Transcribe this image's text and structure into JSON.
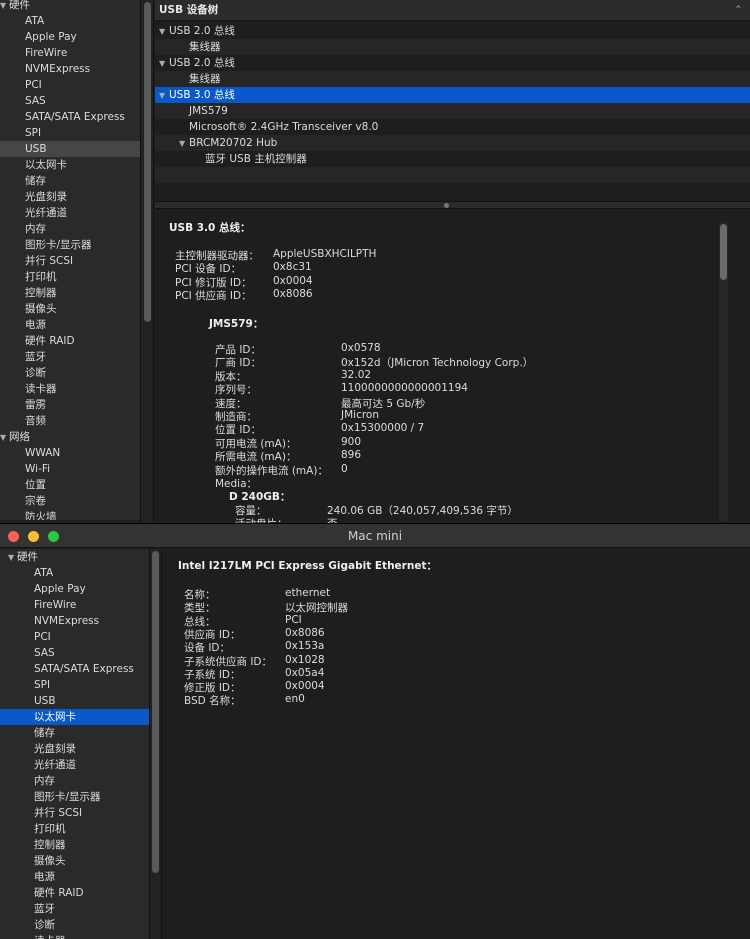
{
  "win1": {
    "sidebar": [
      {
        "kind": "group",
        "label": "硬件",
        "open": true
      },
      {
        "kind": "item",
        "label": "ATA"
      },
      {
        "kind": "item",
        "label": "Apple Pay"
      },
      {
        "kind": "item",
        "label": "FireWire"
      },
      {
        "kind": "item",
        "label": "NVMExpress"
      },
      {
        "kind": "item",
        "label": "PCI"
      },
      {
        "kind": "item",
        "label": "SAS"
      },
      {
        "kind": "item",
        "label": "SATA/SATA Express"
      },
      {
        "kind": "item",
        "label": "SPI"
      },
      {
        "kind": "item",
        "label": "USB",
        "selected": "gray"
      },
      {
        "kind": "item",
        "label": "以太网卡"
      },
      {
        "kind": "item",
        "label": "储存"
      },
      {
        "kind": "item",
        "label": "光盘刻录"
      },
      {
        "kind": "item",
        "label": "光纤通道"
      },
      {
        "kind": "item",
        "label": "内存"
      },
      {
        "kind": "item",
        "label": "图形卡/显示器"
      },
      {
        "kind": "item",
        "label": "并行 SCSI"
      },
      {
        "kind": "item",
        "label": "打印机"
      },
      {
        "kind": "item",
        "label": "控制器"
      },
      {
        "kind": "item",
        "label": "摄像头"
      },
      {
        "kind": "item",
        "label": "电源"
      },
      {
        "kind": "item",
        "label": "硬件 RAID"
      },
      {
        "kind": "item",
        "label": "蓝牙"
      },
      {
        "kind": "item",
        "label": "诊断"
      },
      {
        "kind": "item",
        "label": "读卡器"
      },
      {
        "kind": "item",
        "label": "雷雳"
      },
      {
        "kind": "item",
        "label": "音频"
      },
      {
        "kind": "group",
        "label": "网络",
        "open": true
      },
      {
        "kind": "item",
        "label": "WWAN"
      },
      {
        "kind": "item",
        "label": "Wi-Fi"
      },
      {
        "kind": "item",
        "label": "位置"
      },
      {
        "kind": "item",
        "label": "宗卷"
      },
      {
        "kind": "item",
        "label": "防火墙"
      }
    ],
    "device_tree_title": "USB 设备树",
    "device_tree": [
      {
        "label": "USB 2.0 总线",
        "depth": 0,
        "tri": "▼"
      },
      {
        "label": "集线器",
        "depth": 2
      },
      {
        "label": "USB 2.0 总线",
        "depth": 0,
        "tri": "▼"
      },
      {
        "label": "集线器",
        "depth": 2
      },
      {
        "label": "USB 3.0 总线",
        "depth": 0,
        "tri": "▼",
        "selected": true
      },
      {
        "label": "JMS579",
        "depth": 1
      },
      {
        "label": "Microsoft® 2.4GHz Transceiver v8.0",
        "depth": 1
      },
      {
        "label": "BRCM20702 Hub",
        "depth": 1,
        "tri": "▼"
      },
      {
        "label": "蓝牙 USB 主机控制器",
        "depth": 3
      },
      {
        "label": "",
        "depth": 0
      },
      {
        "label": "",
        "depth": 0
      }
    ],
    "detail": {
      "heading": "USB 3.0 总线：",
      "bus_props": [
        {
          "k": "主控制器驱动器：",
          "v": "AppleUSBXHCILPTH"
        },
        {
          "k": "PCI 设备 ID：",
          "v": "0x8c31"
        },
        {
          "k": "PCI 修订版 ID：",
          "v": "0x0004"
        },
        {
          "k": "PCI 供应商 ID：",
          "v": "0x8086"
        }
      ],
      "device_heading": "JMS579：",
      "device_props": [
        {
          "k": "产品 ID：",
          "v": "0x0578"
        },
        {
          "k": "厂商 ID：",
          "v": "0x152d（JMicron Technology Corp.）"
        },
        {
          "k": "版本：",
          "v": "32.02"
        },
        {
          "k": "序列号：",
          "v": "1100000000000001194"
        },
        {
          "k": "速度：",
          "v": "最高可达 5 Gb/秒"
        },
        {
          "k": "制造商：",
          "v": "JMicron"
        },
        {
          "k": "位置 ID：",
          "v": "0x15300000 / 7"
        },
        {
          "k": "可用电流 (mA)：",
          "v": "900"
        },
        {
          "k": "所需电流 (mA)：",
          "v": "896"
        },
        {
          "k": "额外的操作电流 (mA)：",
          "v": "0"
        }
      ],
      "media_label": "Media：",
      "media_heading": "D 240GB：",
      "media_props": [
        {
          "k": "容量：",
          "v": "240.06 GB（240,057,409,536 字节）"
        },
        {
          "k": "活动盘片：",
          "v": "否"
        }
      ]
    }
  },
  "win2": {
    "title": "Mac mini",
    "sidebar": [
      {
        "kind": "group",
        "label": "硬件",
        "open": true
      },
      {
        "kind": "item",
        "label": "ATA"
      },
      {
        "kind": "item",
        "label": "Apple Pay"
      },
      {
        "kind": "item",
        "label": "FireWire"
      },
      {
        "kind": "item",
        "label": "NVMExpress"
      },
      {
        "kind": "item",
        "label": "PCI"
      },
      {
        "kind": "item",
        "label": "SAS"
      },
      {
        "kind": "item",
        "label": "SATA/SATA Express"
      },
      {
        "kind": "item",
        "label": "SPI"
      },
      {
        "kind": "item",
        "label": "USB"
      },
      {
        "kind": "item",
        "label": "以太网卡",
        "selected": "blue"
      },
      {
        "kind": "item",
        "label": "储存"
      },
      {
        "kind": "item",
        "label": "光盘刻录"
      },
      {
        "kind": "item",
        "label": "光纤通道"
      },
      {
        "kind": "item",
        "label": "内存"
      },
      {
        "kind": "item",
        "label": "图形卡/显示器"
      },
      {
        "kind": "item",
        "label": "并行 SCSI"
      },
      {
        "kind": "item",
        "label": "打印机"
      },
      {
        "kind": "item",
        "label": "控制器"
      },
      {
        "kind": "item",
        "label": "摄像头"
      },
      {
        "kind": "item",
        "label": "电源"
      },
      {
        "kind": "item",
        "label": "硬件 RAID"
      },
      {
        "kind": "item",
        "label": "蓝牙"
      },
      {
        "kind": "item",
        "label": "诊断"
      },
      {
        "kind": "item",
        "label": "读卡器"
      }
    ],
    "detail": {
      "heading": "Intel I217LM PCI Express Gigabit Ethernet：",
      "props": [
        {
          "k": "名称：",
          "v": "ethernet"
        },
        {
          "k": "类型：",
          "v": "以太网控制器"
        },
        {
          "k": "总线：",
          "v": "PCI"
        },
        {
          "k": "供应商 ID：",
          "v": "0x8086"
        },
        {
          "k": "设备 ID：",
          "v": "0x153a"
        },
        {
          "k": "子系统供应商 ID：",
          "v": "0x1028"
        },
        {
          "k": "子系统 ID：",
          "v": "0x05a4"
        },
        {
          "k": "修正版 ID：",
          "v": "0x0004"
        },
        {
          "k": "BSD 名称：",
          "v": "en0"
        }
      ]
    }
  }
}
